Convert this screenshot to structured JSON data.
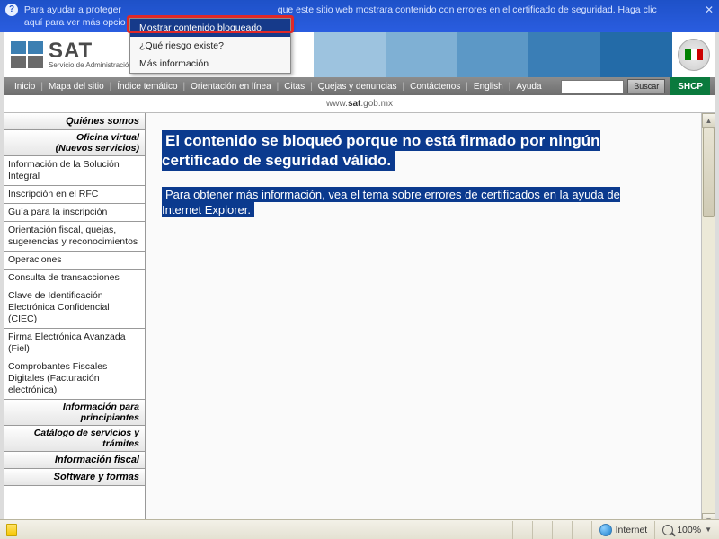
{
  "info_bar": {
    "line1_a": "Para ayudar a proteger",
    "line1_b": "que este sitio web mostrara contenido con errores en el certificado de seguridad. Haga clic",
    "line2": "aquí para ver más opcio"
  },
  "logo": {
    "sat": "SAT",
    "sub": "Servicio de Administración Tributaria"
  },
  "nav": {
    "items": [
      "Inicio",
      "Mapa del sitio",
      "Índice temático",
      "Orientación en línea",
      "Citas",
      "Quejas y denuncias",
      "Contáctenos",
      "English",
      "Ayuda"
    ],
    "search_placeholder": "",
    "search_btn": "Buscar",
    "shcp": "SHCP"
  },
  "url": {
    "prefix": "www.",
    "bold": "sat",
    "suffix": ".gob.mx"
  },
  "sidebar": {
    "head1": "Quiénes somos",
    "sub1a": "Oficina virtual",
    "sub1b": "(Nuevos servicios)",
    "items": [
      "Información de la Solución Integral",
      "Inscripción en el RFC",
      "Guía para la inscripción",
      "Orientación fiscal, quejas, sugerencias y reconocimientos",
      "Operaciones",
      "Consulta de transacciones",
      "Clave de Identificación Electrónica Confidencial (CIEC)",
      "Firma Electrónica Avanzada (Fiel)",
      "Comprobantes Fiscales Digitales (Facturación electrónica)"
    ],
    "head2": "Información para principiantes",
    "head3": "Catálogo de servicios y trámites",
    "head4": "Información fiscal",
    "head5": "Software y formas"
  },
  "content": {
    "title": "El contenido se bloqueó porque no está firmado por ningún certificado de seguridad válido.",
    "body": "Para obtener más información, vea el tema sobre errores de certificados en la ayuda de Internet Explorer."
  },
  "ctx": {
    "items": [
      "Mostrar contenido bloqueado",
      "¿Qué riesgo existe?",
      "Más información"
    ]
  },
  "status": {
    "zone": "Internet",
    "zoom": "100%"
  }
}
